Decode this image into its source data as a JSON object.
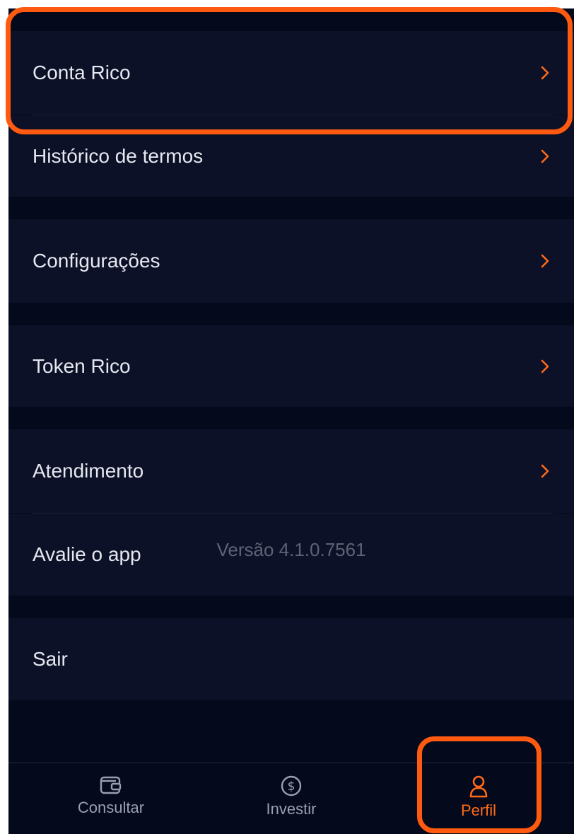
{
  "menu": {
    "items": [
      {
        "label": "Conta Rico"
      },
      {
        "label": "Histórico de termos"
      },
      {
        "label": "Configurações"
      },
      {
        "label": "Token Rico"
      },
      {
        "label": "Atendimento"
      },
      {
        "label": "Avalie o app"
      },
      {
        "label": "Sair"
      }
    ]
  },
  "version_text": "Versão 4.1.0.7561",
  "bottom_nav": {
    "tabs": [
      {
        "label": "Consultar",
        "icon": "wallet-icon"
      },
      {
        "label": "Investir",
        "icon": "dollar-circle-icon"
      },
      {
        "label": "Perfil",
        "icon": "user-icon",
        "active": true
      }
    ]
  },
  "colors": {
    "accent": "#ff6a1a",
    "highlight": "#ff5a0f",
    "background": "#04091c",
    "row": "#0c1128"
  }
}
